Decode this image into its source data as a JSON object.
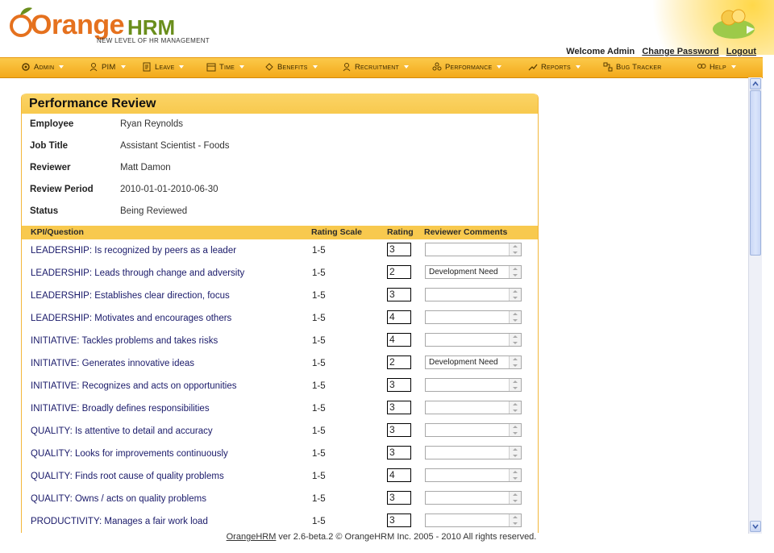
{
  "header": {
    "logo_main": "Orange",
    "logo_hrm": "HRM",
    "logo_tagline": "NEW LEVEL OF HR MANAGEMENT",
    "welcome_text": "Welcome Admin",
    "change_password": "Change Password",
    "logout": "Logout"
  },
  "menu": {
    "items": [
      {
        "label": "Admin",
        "icon": "admin-icon"
      },
      {
        "label": "PIM",
        "icon": "pim-icon"
      },
      {
        "label": "Leave",
        "icon": "leave-icon"
      },
      {
        "label": "Time",
        "icon": "time-icon"
      },
      {
        "label": "Benefits",
        "icon": "benefits-icon"
      },
      {
        "label": "Recruitment",
        "icon": "recruitment-icon"
      },
      {
        "label": "Performance",
        "icon": "performance-icon"
      },
      {
        "label": "Reports",
        "icon": "reports-icon"
      },
      {
        "label": "Bug Tracker",
        "icon": "bug-tracker-icon"
      },
      {
        "label": "Help",
        "icon": "help-icon"
      }
    ]
  },
  "review": {
    "title": "Performance Review",
    "fields": [
      {
        "label": "Employee",
        "value": "Ryan Reynolds"
      },
      {
        "label": "Job Title",
        "value": "Assistant Scientist - Foods"
      },
      {
        "label": "Reviewer",
        "value": "Matt Damon"
      },
      {
        "label": "Review Period",
        "value": "2010-01-01-2010-06-30"
      },
      {
        "label": "Status",
        "value": "Being Reviewed"
      }
    ],
    "columns": {
      "kpi": "KPI/Question",
      "scale": "Rating Scale",
      "rating": "Rating",
      "comments": "Reviewer Comments"
    },
    "kpis": [
      {
        "question": "LEADERSHIP: Is recognized by peers as a leader",
        "scale": "1-5",
        "rating": "3",
        "comment": ""
      },
      {
        "question": "LEADERSHIP: Leads through change and adversity",
        "scale": "1-5",
        "rating": "2",
        "comment": "Development Need"
      },
      {
        "question": "LEADERSHIP: Establishes clear direction, focus",
        "scale": "1-5",
        "rating": "3",
        "comment": ""
      },
      {
        "question": "LEADERSHIP: Motivates and encourages others",
        "scale": "1-5",
        "rating": "4",
        "comment": ""
      },
      {
        "question": "INITIATIVE: Tackles problems and takes risks",
        "scale": "1-5",
        "rating": "4",
        "comment": ""
      },
      {
        "question": "INITIATIVE: Generates innovative ideas",
        "scale": "1-5",
        "rating": "2",
        "comment": "Development Need"
      },
      {
        "question": "INITIATIVE: Recognizes and acts on opportunities",
        "scale": "1-5",
        "rating": "3",
        "comment": ""
      },
      {
        "question": "INITIATIVE: Broadly defines responsibilities",
        "scale": "1-5",
        "rating": "3",
        "comment": ""
      },
      {
        "question": "QUALITY: Is attentive to detail and accuracy",
        "scale": "1-5",
        "rating": "3",
        "comment": ""
      },
      {
        "question": "QUALITY: Looks for improvements continuously",
        "scale": "1-5",
        "rating": "3",
        "comment": ""
      },
      {
        "question": "QUALITY: Finds root cause of quality problems",
        "scale": "1-5",
        "rating": "4",
        "comment": ""
      },
      {
        "question": "QUALITY: Owns / acts on quality problems",
        "scale": "1-5",
        "rating": "3",
        "comment": ""
      },
      {
        "question": "PRODUCTIVITY: Manages a fair work load",
        "scale": "1-5",
        "rating": "3",
        "comment": ""
      }
    ]
  },
  "footer": {
    "link": "OrangeHRM",
    "text": " ver 2.6-beta.2 © OrangeHRM Inc. 2005 - 2010 All rights reserved."
  }
}
